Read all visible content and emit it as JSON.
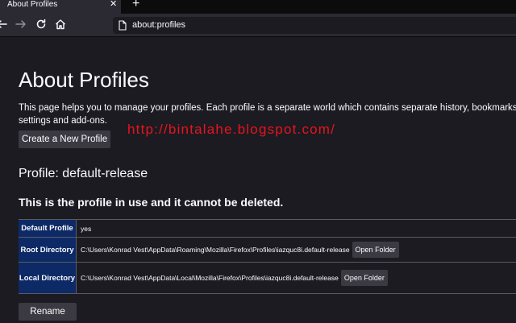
{
  "browser": {
    "tab": {
      "title": "About Profiles",
      "close": "✕"
    },
    "new_tab": "+",
    "url": "about:profiles",
    "icons": [
      "back-arrow-icon",
      "forward-arrow-icon",
      "reload-icon",
      "home-icon",
      "page-icon"
    ]
  },
  "page": {
    "title": "About Profiles",
    "description_line1": "This page helps you to manage your profiles. Each profile is a separate world which contains separate history, bookmarks,",
    "description_line2": "settings and add-ons.",
    "create_button": "Create a New Profile",
    "watermark": "http://bintalahe.blogspot.com/",
    "profile_heading": "Profile: default-release",
    "in_use_notice": "This is the profile in use and it cannot be deleted.",
    "rows": [
      {
        "label": "Default Profile",
        "value": "yes"
      },
      {
        "label": "Root Directory",
        "value": "C:\\Users\\Konrad Vest\\AppData\\Roaming\\Mozilla\\Firefox\\Profiles\\iazquc8i.default-release",
        "button": "Open Folder"
      },
      {
        "label": "Local Directory",
        "value": "C:\\Users\\Konrad Vest\\AppData\\Local\\Mozilla\\Firefox\\Profiles\\iazquc8i.default-release",
        "button": "Open Folder"
      }
    ],
    "rename_button": "Rename"
  },
  "colors": {
    "background": "#1c1b22",
    "toolbar": "#2b2a33",
    "label_cell": "#0d2a66",
    "button": "#3b3a42",
    "watermark": "#e8141d"
  }
}
